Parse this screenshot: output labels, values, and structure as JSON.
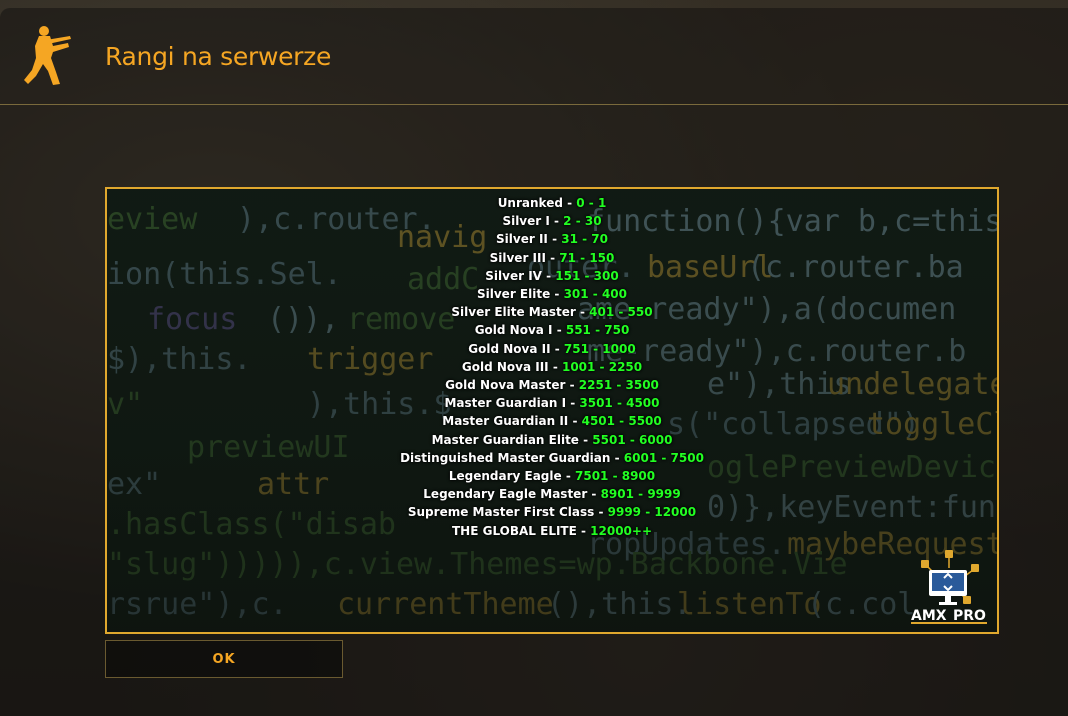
{
  "window": {
    "title": "Rangi na serwerze"
  },
  "ranks": [
    {
      "name": "Unranked",
      "range": "0 - 1"
    },
    {
      "name": "Silver I",
      "range": "2 - 30"
    },
    {
      "name": "Silver II",
      "range": "31 - 70"
    },
    {
      "name": "Silver III",
      "range": "71 - 150"
    },
    {
      "name": "Silver IV",
      "range": "151 - 300"
    },
    {
      "name": "Silver Elite",
      "range": "301 - 400"
    },
    {
      "name": "Silver Elite Master",
      "range": "401 - 550"
    },
    {
      "name": "Gold Nova I",
      "range": "551 - 750"
    },
    {
      "name": "Gold Nova II",
      "range": "751 - 1000"
    },
    {
      "name": "Gold Nova III",
      "range": "1001 - 2250"
    },
    {
      "name": "Gold Nova Master",
      "range": "2251 - 3500"
    },
    {
      "name": "Master Guardian I",
      "range": "3501 - 4500"
    },
    {
      "name": "Master Guardian II",
      "range": "4501 - 5500"
    },
    {
      "name": "Master Guardian Elite",
      "range": "5501 - 6000"
    },
    {
      "name": "Distinguished Master Guardian",
      "range": "6001 - 7500"
    },
    {
      "name": "Legendary Eagle",
      "range": "7501 - 8900"
    },
    {
      "name": "Legendary Eagle Master",
      "range": "8901 - 9999"
    },
    {
      "name": "Supreme Master First Class",
      "range": "9999 - 12000"
    },
    {
      "name": "THE GLOBAL ELITE",
      "range": "12000++"
    }
  ],
  "separator": " - ",
  "logo": {
    "text_a": "AMX",
    "text_b": "PRO",
    "icon": "amxx-pro-logo"
  },
  "game_icon": "counter-strike-logo-icon",
  "buttons": {
    "ok_label": "OK"
  },
  "colors": {
    "title": "#f5a623",
    "accent_border": "#e0a82e",
    "range": "#22ff22",
    "rank_name": "#ffffff"
  }
}
